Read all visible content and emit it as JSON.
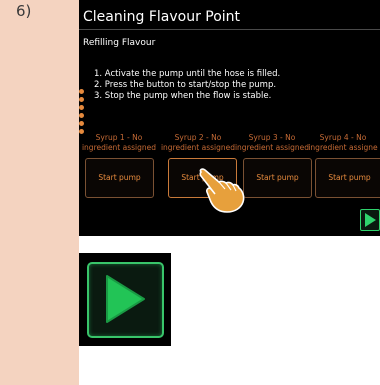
{
  "step": {
    "number": "6)"
  },
  "screen": {
    "title": "Cleaning Flavour Point",
    "subtitle": "Refilling Flavour",
    "instructions": [
      "1. Activate the pump until the hose is filled.",
      "2. Press the button to start/stop the pump.",
      "3. Stop the pump when the flow is stable."
    ],
    "syrups": [
      {
        "line1": "Syrup 1 - No",
        "line2": "ingredient assigned"
      },
      {
        "line1": "Syrup 2 - No",
        "line2": "ingredient assigned"
      },
      {
        "line1": "Syrup 3 - No",
        "line2": "ingredient assigned"
      },
      {
        "line1": "Syrup 4 - No",
        "line2": "ingredient assigne"
      }
    ],
    "pump_buttons": [
      "Start pump",
      "Start pump",
      "Start pump",
      "Start pump"
    ]
  },
  "icons": {
    "next": "play-icon",
    "pointer": "pointing-hand-icon",
    "enlarged": "play-button-enlarged-icon"
  },
  "colors": {
    "accent_orange": "#e68a3d",
    "play_green": "#2fd36d",
    "left_band": "#f4d3c0"
  }
}
